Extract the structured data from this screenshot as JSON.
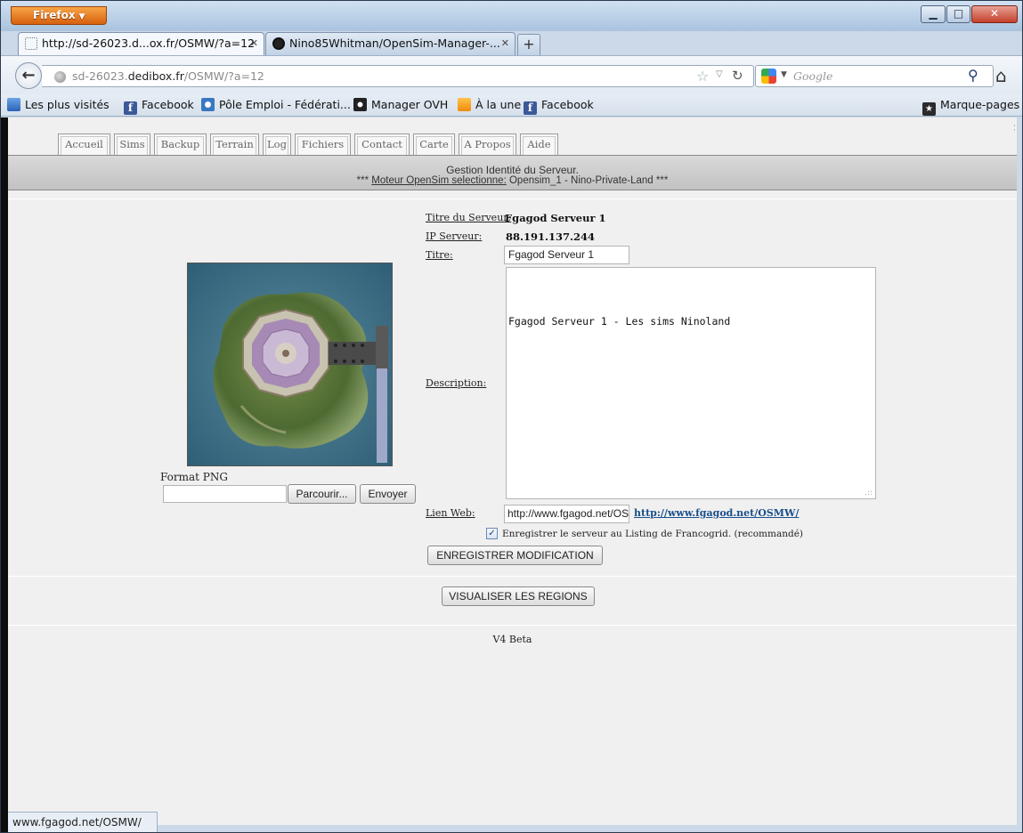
{
  "browser": {
    "app_button": "Firefox",
    "window_controls": {
      "minimize": "▁",
      "maximize": "□",
      "close": "✕"
    },
    "tabs": [
      {
        "title": "http://sd-26023.d...ox.fr/OSMW/?a=12",
        "active": true
      },
      {
        "title": "Nino85Whitman/OpenSim-Manager-...",
        "active": false
      }
    ],
    "new_tab": "+",
    "url": {
      "prefix": "sd-26023.",
      "domain": "dedibox.fr",
      "path": "/OSMW/?a=12"
    },
    "search": {
      "engine_icon": "google-icon",
      "placeholder": "Google"
    },
    "bookmarks": [
      {
        "label": "Les plus visités",
        "icon": "bookmark-blue-icon"
      },
      {
        "label": "Facebook",
        "icon": "facebook-icon"
      },
      {
        "label": "Pôle Emploi - Fédérati...",
        "icon": "pole-emploi-icon"
      },
      {
        "label": "Manager OVH",
        "icon": "ovh-icon"
      },
      {
        "label": "À la une",
        "icon": "rss-icon"
      },
      {
        "label": "Facebook",
        "icon": "facebook-icon"
      }
    ],
    "bookmarks_menu": "Marque-pages",
    "status_text": "www.fgagod.net/OSMW/"
  },
  "page": {
    "menu": [
      "Accueil",
      "Sims",
      "Backup",
      "Terrain",
      "Log",
      "Fichiers",
      "Contact",
      "Carte",
      "A Propos",
      "Aide"
    ],
    "banner": {
      "title": "Gestion Identité du Serveur.",
      "engine_prefix": "***",
      "engine_label": "Moteur OpenSim selectionne:",
      "engine_value": "Opensim_1 - Nino-Private-Land",
      "engine_suffix": "***"
    },
    "form": {
      "server_title_label": "Titre du Serveur:",
      "server_title_value": "Fgagod Serveur 1",
      "ip_label": "IP Serveur:",
      "ip_value": "88.191.137.244",
      "titre_label": "Titre:",
      "titre_value": "Fgagod Serveur 1",
      "description_label": "Description:",
      "description_value": "Fgagod Serveur 1 - Les sims Ninoland",
      "web_label": "Lien Web:",
      "web_value": "http://www.fgagod.net/OSMW/",
      "web_link": "http://www.fgagod.net/OSMW/",
      "listing_label": "Enregistrer le serveur au Listing de Francogrid. (recommandé)",
      "listing_checked": true,
      "save_button": "ENREGISTRER MODIFICATION"
    },
    "upload": {
      "format_label": "Format PNG",
      "browse_button": "Parcourir...",
      "send_button": "Envoyer"
    },
    "regions_button": "VISUALISER LES REGIONS",
    "version": "V4 Beta"
  }
}
